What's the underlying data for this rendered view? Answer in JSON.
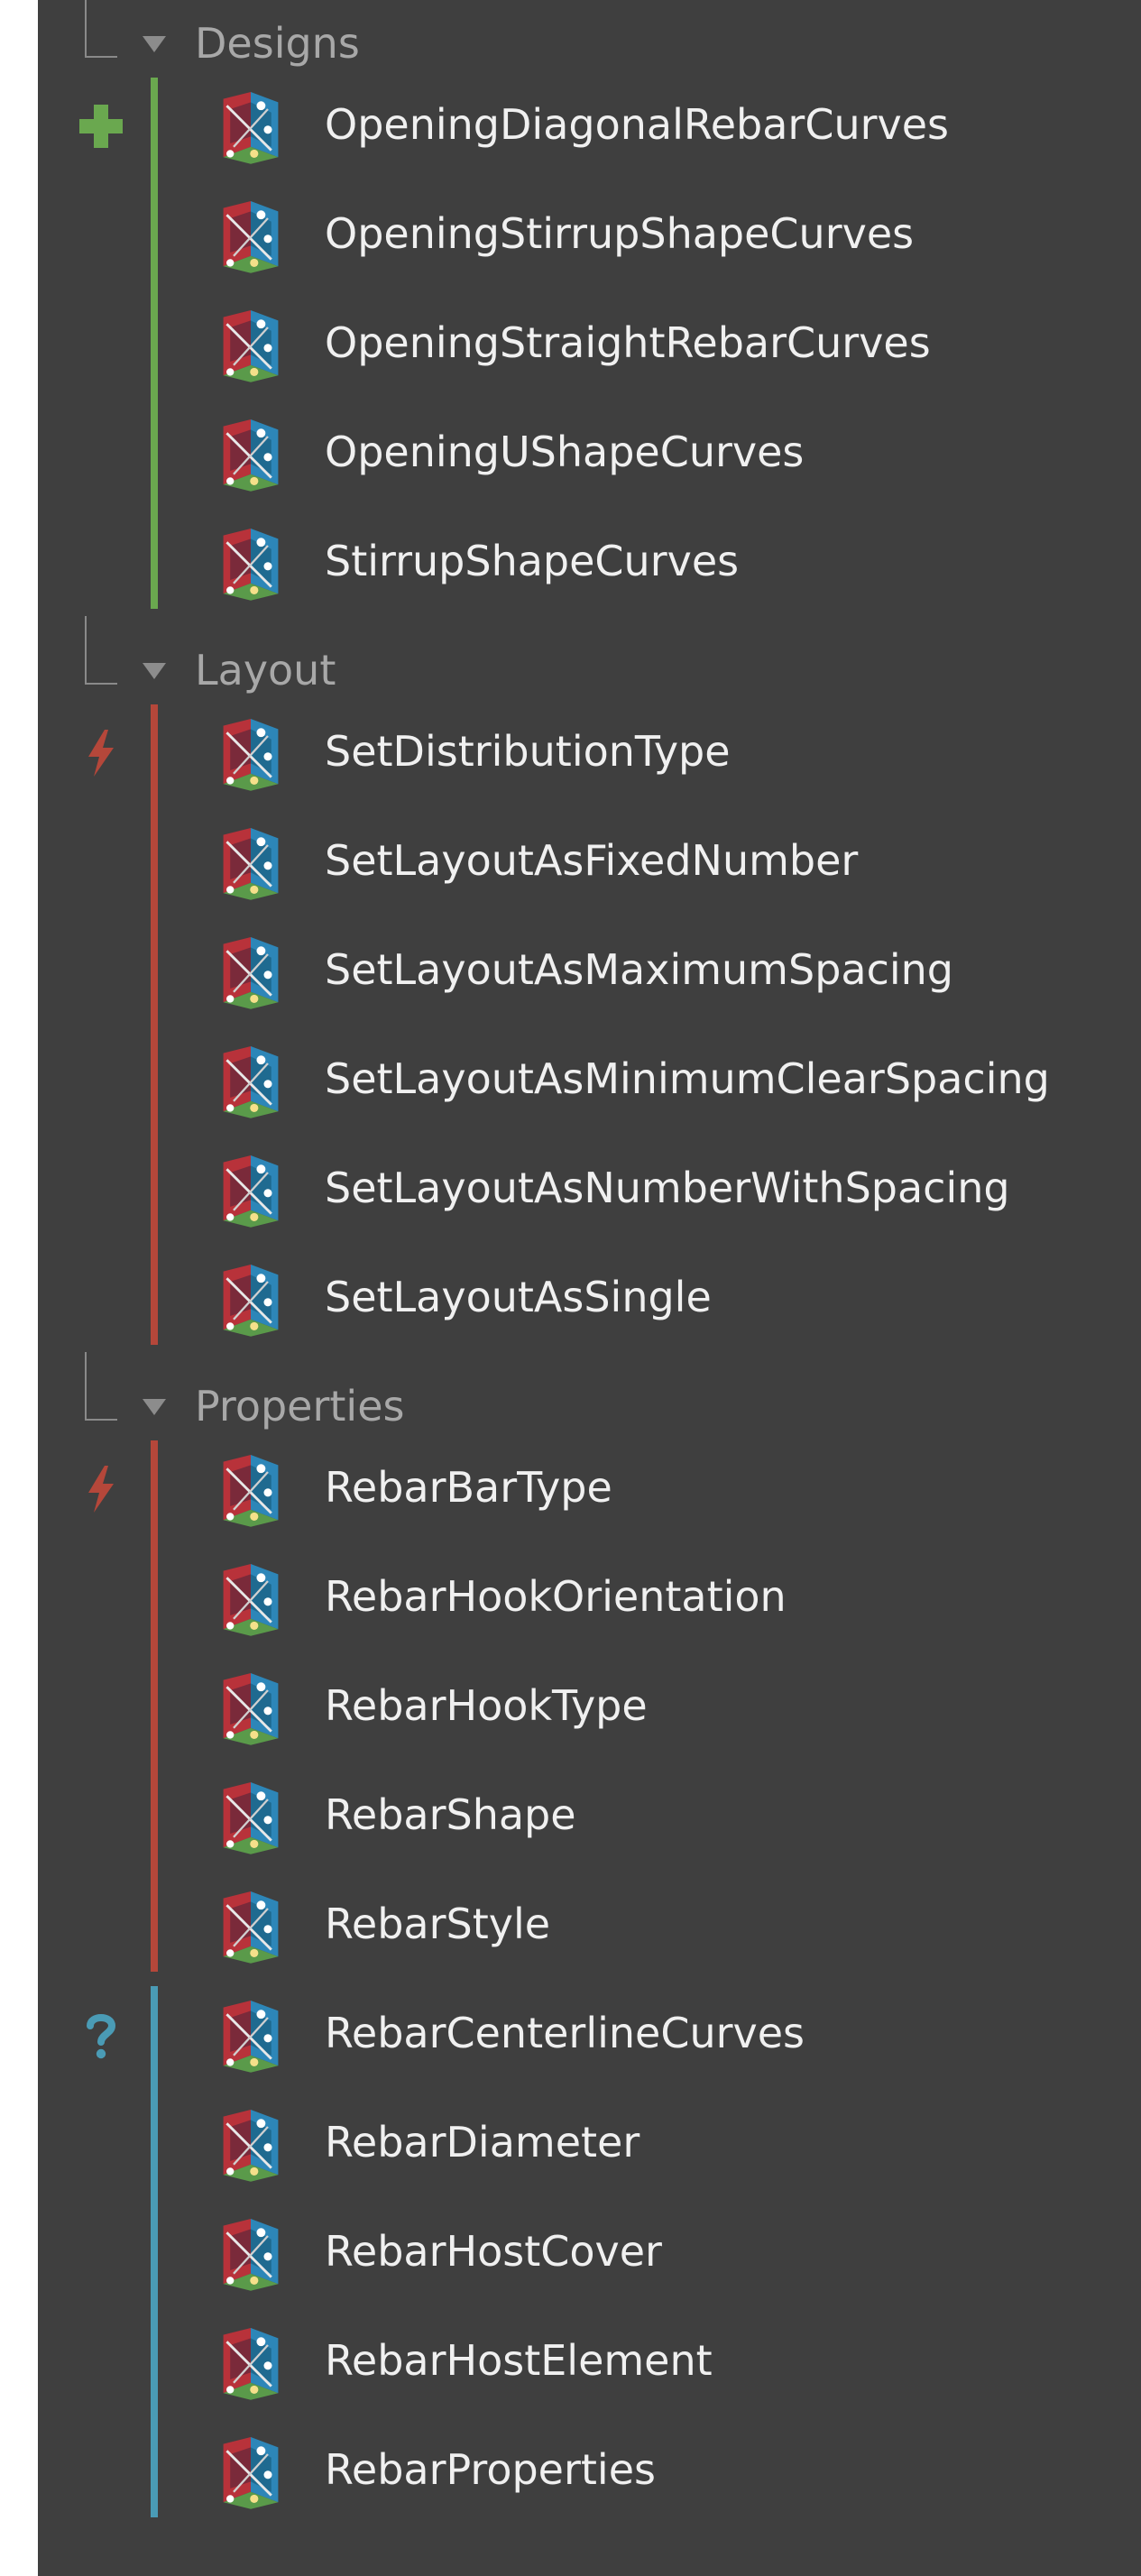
{
  "colors": {
    "panel_bg": "#3f3f3f",
    "add_green": "#6aa84f",
    "action_red": "#b5473a",
    "query_blue": "#4a9bb5"
  },
  "icons": {
    "add": "plus-icon",
    "action": "lightning-icon",
    "query": "question-icon",
    "node": "dynamo-node-icon"
  },
  "groups": [
    {
      "label": "Designs",
      "sections": [
        {
          "kind": "add",
          "items": [
            "OpeningDiagonalRebarCurves",
            "OpeningStirrupShapeCurves",
            "OpeningStraightRebarCurves",
            "OpeningUShapeCurves",
            "StirrupShapeCurves"
          ]
        }
      ]
    },
    {
      "label": "Layout",
      "sections": [
        {
          "kind": "action",
          "items": [
            "SetDistributionType",
            "SetLayoutAsFixedNumber",
            "SetLayoutAsMaximumSpacing",
            "SetLayoutAsMinimumClearSpacing",
            "SetLayoutAsNumberWithSpacing",
            "SetLayoutAsSingle"
          ]
        }
      ]
    },
    {
      "label": "Properties",
      "sections": [
        {
          "kind": "action",
          "items": [
            "RebarBarType",
            "RebarHookOrientation",
            "RebarHookType",
            "RebarShape",
            "RebarStyle"
          ]
        },
        {
          "kind": "query",
          "items": [
            "RebarCenterlineCurves",
            "RebarDiameter",
            "RebarHostCover",
            "RebarHostElement",
            "RebarProperties"
          ]
        }
      ]
    }
  ]
}
